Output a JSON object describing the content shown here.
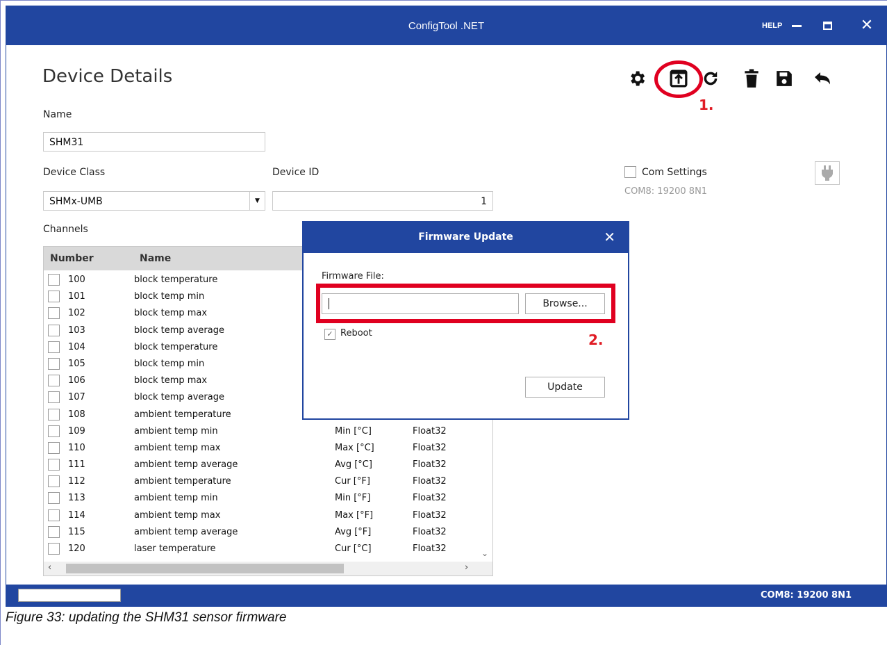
{
  "window": {
    "title": "ConfigTool .NET",
    "help_label": "HELP"
  },
  "page": {
    "heading": "Device Details"
  },
  "form": {
    "name_label": "Name",
    "name_value": "SHM31",
    "device_class_label": "Device Class",
    "device_class_value": "SHMx-UMB",
    "device_id_label": "Device ID",
    "device_id_value": "1",
    "com_settings_label": "Com Settings",
    "com_settings_value": "COM8: 19200 8N1",
    "channels_label": "Channels"
  },
  "toolbar": {
    "icons": [
      "gear-icon",
      "firmware-upload-icon",
      "refresh-icon",
      "delete-icon",
      "save-icon",
      "undo-icon"
    ]
  },
  "annotations": {
    "step1": "1.",
    "step2": "2."
  },
  "table": {
    "columns": [
      "Number",
      "Name"
    ],
    "rows": [
      {
        "number": "100",
        "name": "block temperature",
        "unit": "",
        "type": ""
      },
      {
        "number": "101",
        "name": "block temp min",
        "unit": "",
        "type": ""
      },
      {
        "number": "102",
        "name": "block temp max",
        "unit": "",
        "type": ""
      },
      {
        "number": "103",
        "name": "block temp average",
        "unit": "",
        "type": ""
      },
      {
        "number": "104",
        "name": "block temperature",
        "unit": "",
        "type": ""
      },
      {
        "number": "105",
        "name": "block temp min",
        "unit": "",
        "type": ""
      },
      {
        "number": "106",
        "name": "block temp max",
        "unit": "",
        "type": ""
      },
      {
        "number": "107",
        "name": "block temp average",
        "unit": "",
        "type": ""
      },
      {
        "number": "108",
        "name": "ambient temperature",
        "unit": "Cur [°C]",
        "type": "Float32"
      },
      {
        "number": "109",
        "name": "ambient temp min",
        "unit": "Min [°C]",
        "type": "Float32"
      },
      {
        "number": "110",
        "name": "ambient temp max",
        "unit": "Max [°C]",
        "type": "Float32"
      },
      {
        "number": "111",
        "name": "ambient temp average",
        "unit": "Avg [°C]",
        "type": "Float32"
      },
      {
        "number": "112",
        "name": "ambient temperature",
        "unit": "Cur [°F]",
        "type": "Float32"
      },
      {
        "number": "113",
        "name": "ambient temp min",
        "unit": "Min [°F]",
        "type": "Float32"
      },
      {
        "number": "114",
        "name": "ambient temp max",
        "unit": "Max [°F]",
        "type": "Float32"
      },
      {
        "number": "115",
        "name": "ambient temp average",
        "unit": "Avg [°F]",
        "type": "Float32"
      },
      {
        "number": "120",
        "name": "laser temperature",
        "unit": "Cur [°C]",
        "type": "Float32"
      }
    ]
  },
  "dialog": {
    "title": "Firmware Update",
    "file_label": "Firmware File:",
    "file_value": "",
    "browse_label": "Browse...",
    "reboot_label": "Reboot",
    "reboot_checked": true,
    "update_label": "Update"
  },
  "statusbar": {
    "text": "COM8: 19200 8N1"
  },
  "caption": "Figure 33: updating the SHM31 sensor firmware",
  "colors": {
    "titlebar": "#2146a0",
    "annotation": "#e00020"
  }
}
